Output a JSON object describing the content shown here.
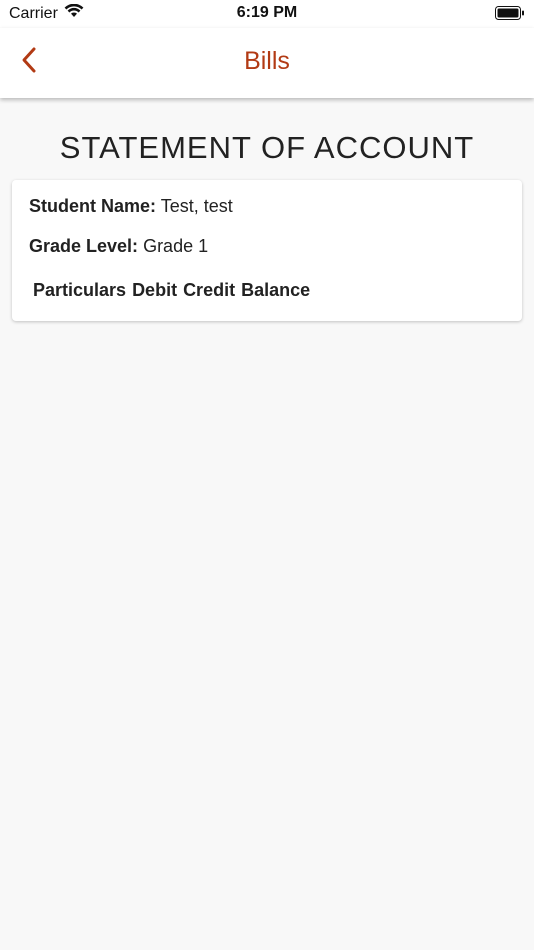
{
  "status_bar": {
    "carrier": "Carrier",
    "time": "6:19 PM",
    "icons": [
      "wifi-icon",
      "battery-icon"
    ]
  },
  "nav": {
    "title": "Bills",
    "back_icon": "chevron-left-icon",
    "accent_color": "#b23a14"
  },
  "page": {
    "heading": "STATEMENT OF ACCOUNT"
  },
  "student": {
    "name_label": "Student Name:",
    "name_value": "Test, test",
    "grade_label": "Grade Level:",
    "grade_value": "Grade 1"
  },
  "table": {
    "columns": [
      "Particulars",
      "Debit",
      "Credit",
      "Balance"
    ]
  }
}
